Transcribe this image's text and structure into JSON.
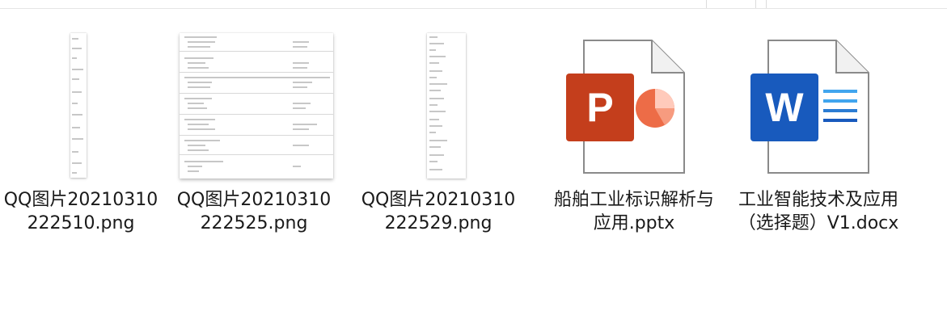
{
  "files": [
    {
      "name": "QQ图片20210310222510.png",
      "type": "png-image",
      "icon": "image-thumbnail-icon"
    },
    {
      "name": "QQ图片20210310222525.png",
      "type": "png-image",
      "icon": "image-thumbnail-icon"
    },
    {
      "name": "QQ图片20210310222529.png",
      "type": "png-image",
      "icon": "image-thumbnail-icon"
    },
    {
      "name": "船舶工业标识解析与应用.pptx",
      "type": "powerpoint",
      "icon": "powerpoint-file-icon"
    },
    {
      "name": "工业智能技术及应用（选择题）V1.docx",
      "type": "word",
      "icon": "word-file-icon"
    }
  ],
  "colors": {
    "powerpoint_accent": "#C43E1C",
    "powerpoint_pie": "#ED6C47",
    "word_accent": "#185ABD",
    "word_lines": "#41A5EE",
    "text": "#1a1a1a"
  }
}
